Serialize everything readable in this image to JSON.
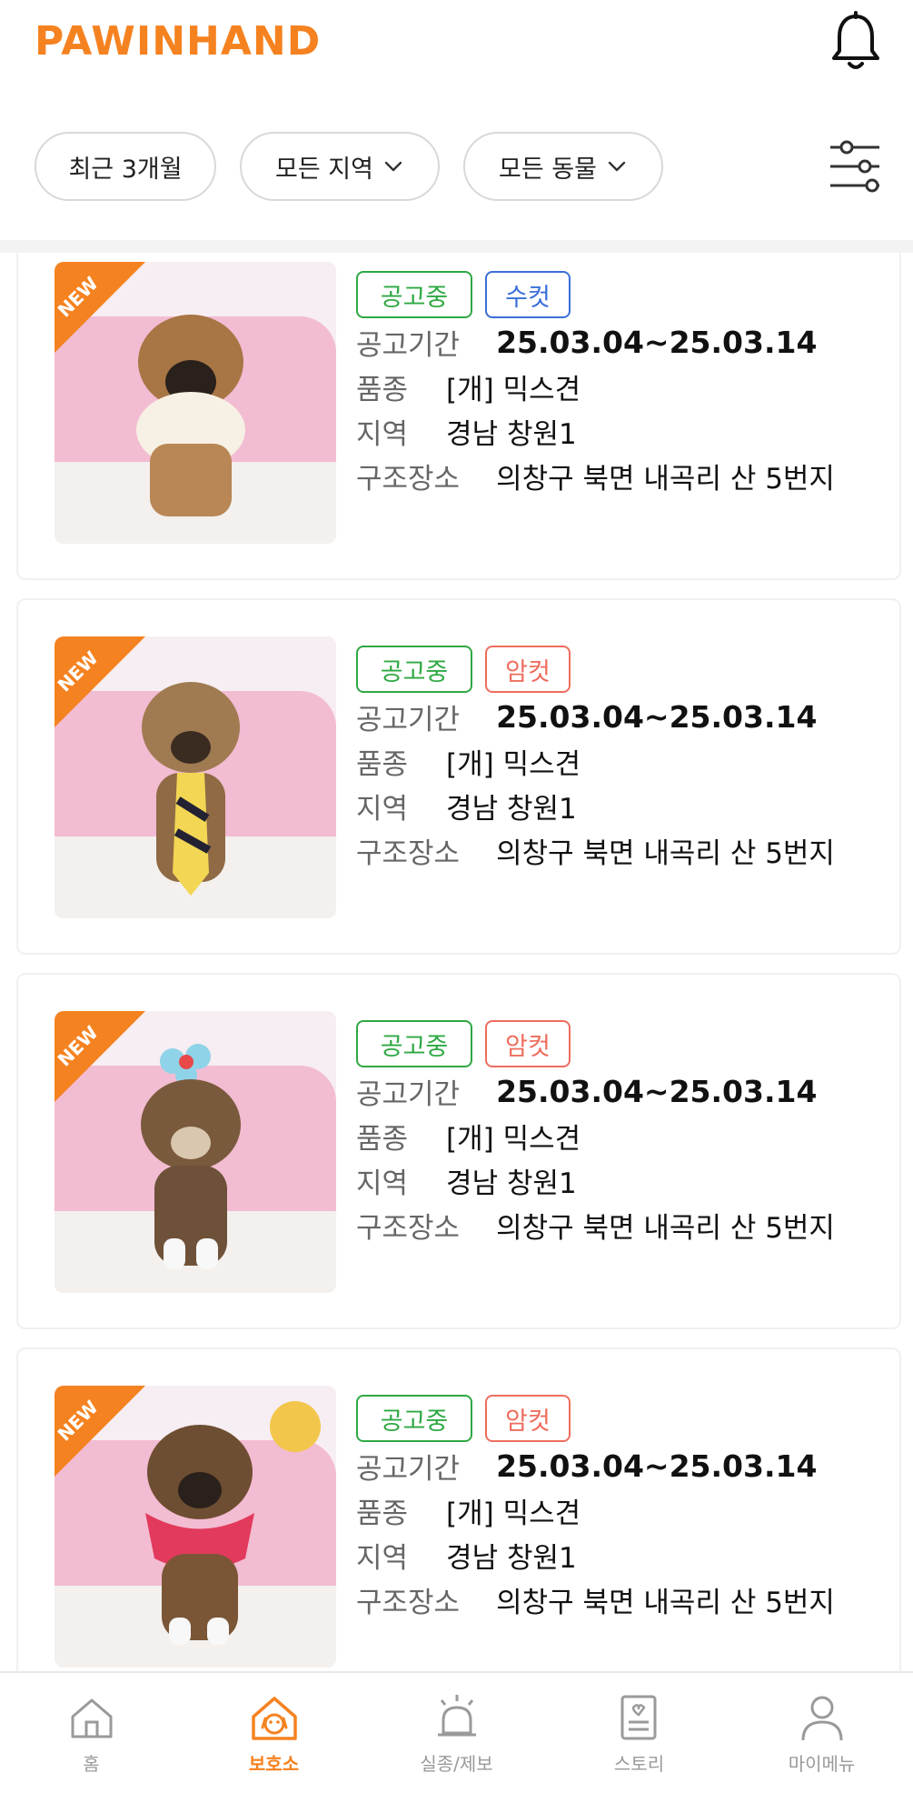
{
  "header": {
    "logo": "PAWINHAND",
    "filters": [
      {
        "label": "최근 3개월"
      },
      {
        "label": "모든 지역"
      },
      {
        "label": "모든 동물"
      }
    ]
  },
  "badge_text": "NEW",
  "labels": {
    "period": "공고기간",
    "breed": "품종",
    "region": "지역",
    "rescue_place": "구조장소"
  },
  "cards": [
    {
      "status": "공고중",
      "sex": "수컷",
      "period": "25.03.04~25.03.14",
      "breed": "[개] 믹스견",
      "region": "경남 창원1",
      "rescue_place": "의창구 북면 내곡리 산 5번지"
    },
    {
      "status": "공고중",
      "sex": "암컷",
      "period": "25.03.04~25.03.14",
      "breed": "[개] 믹스견",
      "region": "경남 창원1",
      "rescue_place": "의창구 북면 내곡리 산 5번지"
    },
    {
      "status": "공고중",
      "sex": "암컷",
      "period": "25.03.04~25.03.14",
      "breed": "[개] 믹스견",
      "region": "경남 창원1",
      "rescue_place": "의창구 북면 내곡리 산 5번지"
    },
    {
      "status": "공고중",
      "sex": "암컷",
      "period": "25.03.04~25.03.14",
      "breed": "[개] 믹스견",
      "region": "경남 창원1",
      "rescue_place": "의창구 북면 내곡리 산 5번지"
    }
  ],
  "bottom_nav": [
    {
      "label": "홈",
      "icon": "home-icon"
    },
    {
      "label": "보호소",
      "icon": "shelter-icon",
      "active": true
    },
    {
      "label": "실종/제보",
      "icon": "siren-icon"
    },
    {
      "label": "스토리",
      "icon": "story-icon"
    },
    {
      "label": "마이메뉴",
      "icon": "person-icon"
    }
  ],
  "colors": {
    "brand": "#f58220",
    "status_green": "#2fa843",
    "male_blue": "#3a6fd8",
    "female_red": "#ee6d5e"
  }
}
